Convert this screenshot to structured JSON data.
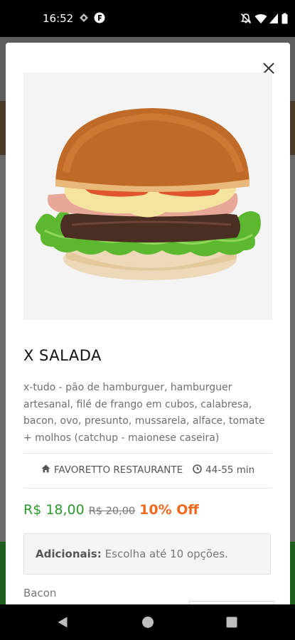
{
  "status_bar": {
    "time": "16:52",
    "icons": [
      "diamond-icon",
      "app-f-icon",
      "mute-icon",
      "wifi-icon",
      "signal-icon",
      "battery-icon"
    ]
  },
  "modal": {
    "close_icon": "close-icon",
    "product": {
      "image": "burger-photo",
      "title": "X SALADA",
      "description": "x-tudo - pão de hamburguer, hamburguer artesanal, filé de frango em cubos, calabresa, bacon, ovo, presunto, mussarela, alface, tomate + molhos (catchup - maionese caseira)",
      "restaurant": "FAVORETTO RESTAURANTE",
      "delivery_time": "44-55 min",
      "price": "R$ 18,00",
      "old_price": "R$ 20,00",
      "discount": "10% Off"
    },
    "addons": {
      "label": "Adicionais:",
      "hint": "Escolha até 10 opções.",
      "items": [
        "Bacon"
      ]
    }
  },
  "nav_bar": {
    "icons": [
      "back-icon",
      "home-icon",
      "recents-icon"
    ]
  },
  "colors": {
    "price": "#2e9a2e",
    "discount": "#ef6a1e",
    "background_overlay": "#6b6b6b"
  }
}
